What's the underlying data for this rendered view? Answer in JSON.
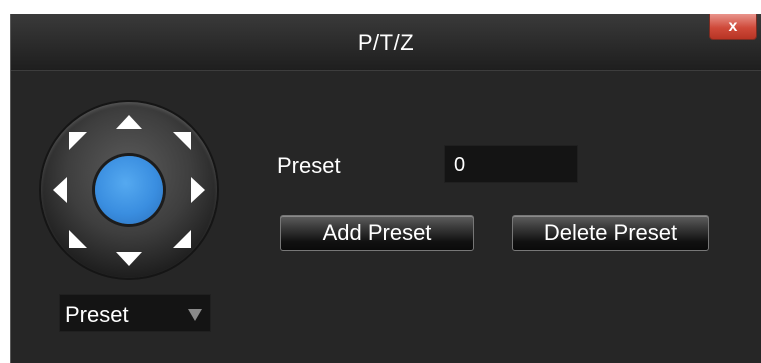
{
  "window": {
    "title": "P/T/Z",
    "close_glyph": "x"
  },
  "dpad": {
    "arrows": [
      "up-icon",
      "up-right-icon",
      "right-icon",
      "down-right-icon",
      "down-icon",
      "down-left-icon",
      "left-icon",
      "up-left-icon"
    ],
    "center_color": "#3a8ee0"
  },
  "preset": {
    "label": "Preset",
    "value": "0"
  },
  "buttons": {
    "add": "Add Preset",
    "delete": "Delete Preset"
  },
  "mode_select": {
    "value": "Preset",
    "caret_icon": "chevron-down-icon"
  }
}
